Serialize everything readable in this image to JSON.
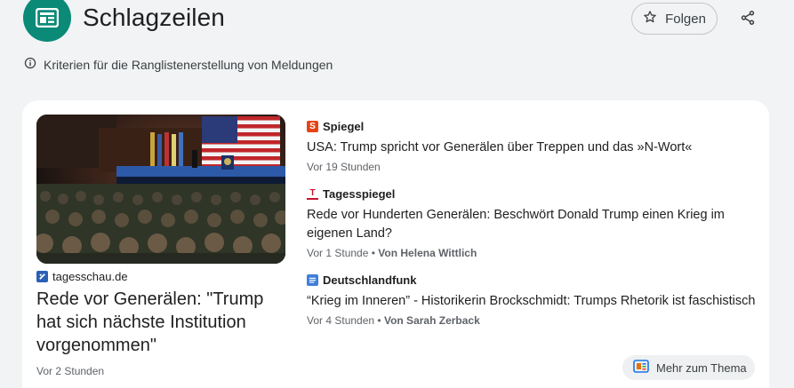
{
  "header": {
    "title": "Schlagzeilen",
    "follow_label": "Folgen",
    "criteria_text": "Kriterien für die Ranglistenerstellung von Meldungen"
  },
  "main_story": {
    "source": "tagesschau.de",
    "headline": "Rede vor Generälen: \"Trump hat sich nächste Institution vorgenommen\"",
    "time": "Vor 2 Stunden"
  },
  "stories": [
    {
      "source": "Spiegel",
      "logo_char": "S",
      "headline": "USA: Trump spricht vor Generälen über Treppen und das »N-Wort«",
      "time": "Vor 19 Stunden",
      "author": ""
    },
    {
      "source": "Tagesspiegel",
      "logo_char": "T",
      "headline": "Rede vor Hunderten Generälen: Beschwört Donald Trump einen Krieg im eigenen Land?",
      "time": "Vor 1 Stunde",
      "author": "Von Helena Wittlich"
    },
    {
      "source": "Deutschlandfunk",
      "logo_char": "",
      "headline": "“Krieg im Inneren” - Historikerin Brockschmidt: Trumps Rhetorik ist faschistisch",
      "time": "Vor 4 Stunden",
      "author": "Von Sarah Zerback"
    }
  ],
  "more_button": {
    "label": "Mehr zum Thema"
  },
  "colors": {
    "topic_logo": "#0a8a77",
    "spiegel": "#e64415",
    "tagesspiegel": "#c8102e",
    "deutschlandfunk": "#3f7fd9",
    "tagesschau": "#2a5fb5"
  },
  "icons": {
    "topic": "newspaper-icon",
    "follow": "star-outline-icon",
    "share": "share-icon",
    "criteria": "info-icon",
    "more": "topic-icon"
  }
}
